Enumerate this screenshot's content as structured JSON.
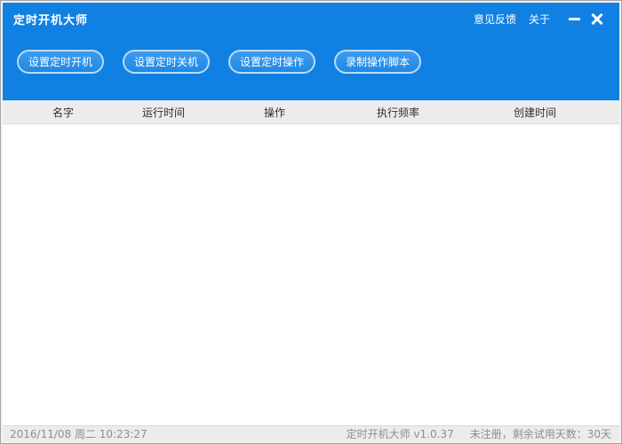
{
  "window": {
    "title": "定时开机大师",
    "titlebar_links": [
      {
        "label": "意见反馈"
      },
      {
        "label": "关于"
      }
    ]
  },
  "toolbar": {
    "buttons": [
      {
        "label": "设置定时开机"
      },
      {
        "label": "设置定时关机"
      },
      {
        "label": "设置定时操作"
      },
      {
        "label": "录制操作脚本"
      }
    ]
  },
  "task_table": {
    "columns": [
      "名字",
      "运行时间",
      "操作",
      "执行频率",
      "创建时间"
    ],
    "rows": []
  },
  "statusbar": {
    "datetime": "2016/11/08 周二 10:23:27",
    "app_version": "定时开机大师 v1.0.37",
    "license_status": "未注册，剩余试用天数：30天"
  },
  "colors": {
    "accent_blue": "#1081e2",
    "button_fill": "#2a91e8",
    "button_border": "#b9dbf8",
    "header_gray": "#ececec",
    "status_gray": "#ececec",
    "status_text": "#8f8f8f"
  }
}
